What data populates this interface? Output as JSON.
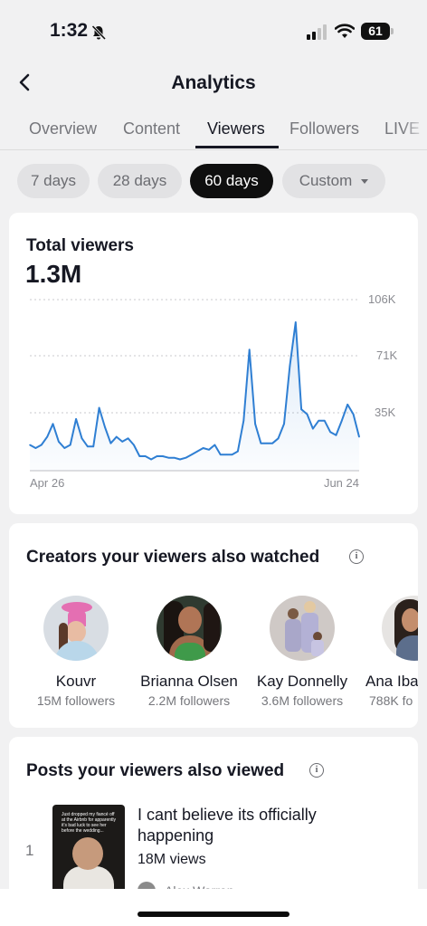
{
  "status": {
    "time": "1:32",
    "battery": "61"
  },
  "header": {
    "title": "Analytics"
  },
  "tabs": [
    {
      "label": "Overview"
    },
    {
      "label": "Content"
    },
    {
      "label": "Viewers"
    },
    {
      "label": "Followers"
    },
    {
      "label": "LIVE"
    }
  ],
  "active_tab": "Viewers",
  "ranges": [
    {
      "label": "7 days"
    },
    {
      "label": "28 days"
    },
    {
      "label": "60 days"
    },
    {
      "label": "Custom"
    }
  ],
  "active_range": "60 days",
  "total_viewers": {
    "title": "Total viewers",
    "value": "1.3M"
  },
  "chart_data": {
    "type": "area",
    "x_start_label": "Apr 26",
    "x_end_label": "Jun 24",
    "y_ticks": [
      "35K",
      "71K",
      "106K"
    ],
    "ylim": [
      0,
      106000
    ],
    "grid": true,
    "color": "#2f7fd3",
    "values": [
      16000,
      14000,
      16000,
      21000,
      29000,
      18000,
      14000,
      16000,
      32000,
      20000,
      15000,
      15000,
      39000,
      27000,
      17000,
      21000,
      18000,
      20000,
      16000,
      9000,
      9000,
      7000,
      9000,
      9000,
      8000,
      8000,
      7000,
      8000,
      10000,
      12000,
      14000,
      13000,
      16000,
      10000,
      10000,
      10000,
      12000,
      31000,
      75000,
      29000,
      17000,
      17000,
      17000,
      20000,
      29000,
      65000,
      92000,
      38000,
      35000,
      26000,
      31000,
      31000,
      24000,
      22000,
      31000,
      41000,
      35000,
      21000
    ]
  },
  "creators_section": {
    "title": "Creators your viewers also watched",
    "creators": [
      {
        "name": "Kouvr",
        "followers": "15M followers"
      },
      {
        "name": "Brianna Olsen",
        "followers": "2.2M followers"
      },
      {
        "name": "Kay Donnelly",
        "followers": "3.6M followers"
      },
      {
        "name": "Ana  Iba",
        "followers": "788K fo"
      }
    ]
  },
  "posts_section": {
    "title": "Posts your viewers also viewed",
    "posts": [
      {
        "rank": "1",
        "thumb_caption": "Just dropped my fiancé off at the Airbnb for apparently it's bad luck to see her before the wedding...",
        "title": "I cant believe its officially happening",
        "views": "18M views",
        "author": "Alex Warren"
      }
    ]
  }
}
